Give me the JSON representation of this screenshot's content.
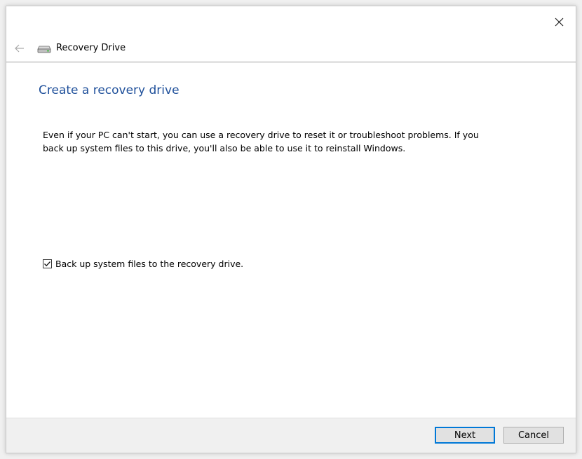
{
  "header": {
    "title": "Recovery Drive",
    "back_icon": "back-arrow-icon",
    "drive_icon": "drive-icon"
  },
  "main": {
    "heading": "Create a recovery drive",
    "description": "Even if your PC can't start, you can use a recovery drive to reset it or troubleshoot problems. If you back up system files to this drive, you'll also be able to use it to reinstall Windows.",
    "checkbox": {
      "label": "Back up system files to the recovery drive.",
      "checked": true
    }
  },
  "footer": {
    "next_label": "Next",
    "cancel_label": "Cancel"
  },
  "colors": {
    "heading": "#1e4f9a",
    "primary_border": "#0078d7",
    "button_bg": "#e1e1e1",
    "footer_bg": "#f0f0f0"
  }
}
